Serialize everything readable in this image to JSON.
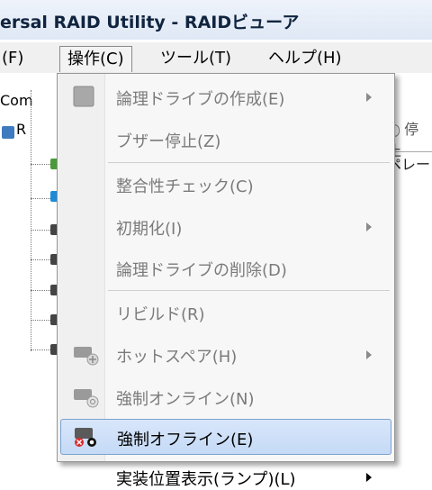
{
  "window": {
    "title": "ersal RAID Utility - RAIDビューア"
  },
  "menubar": {
    "items": [
      "(F)",
      "操作(C)",
      "ツール(T)",
      "ヘルプ(H)"
    ]
  },
  "tree": {
    "root_label": "Com",
    "node_label": "R"
  },
  "right_pane": {
    "button": "停止",
    "tab": "ペレー"
  },
  "menu": {
    "items": [
      {
        "text": "論理ドライブの作成(E)",
        "enabled": false,
        "submenu": true,
        "icon": "disk-gray-icon"
      },
      {
        "text": "ブザー停止(Z)",
        "enabled": false,
        "submenu": false,
        "icon": ""
      },
      {
        "text": "整合性チェック(C)",
        "enabled": false,
        "submenu": false,
        "icon": ""
      },
      {
        "text": "初期化(I)",
        "enabled": false,
        "submenu": true,
        "icon": ""
      },
      {
        "text": "論理ドライブの削除(D)",
        "enabled": false,
        "submenu": false,
        "icon": ""
      },
      {
        "text": "リビルド(R)",
        "enabled": false,
        "submenu": false,
        "icon": ""
      },
      {
        "text": "ホットスペア(H)",
        "enabled": false,
        "submenu": true,
        "icon": "hotspare-drive-icon"
      },
      {
        "text": "強制オンライン(N)",
        "enabled": false,
        "submenu": false,
        "icon": "force-online-drive-icon"
      },
      {
        "text": "強制オフライン(E)",
        "enabled": true,
        "submenu": false,
        "highlighted": true,
        "icon": "force-offline-drive-icon"
      },
      {
        "text": "実装位置表示(ランプ)(L)",
        "enabled": true,
        "submenu": true,
        "icon": ""
      }
    ]
  },
  "colors": {
    "highlight": "#c9dcf5",
    "disabled_text": "#7b7b7b",
    "title_text": "#10243f"
  }
}
